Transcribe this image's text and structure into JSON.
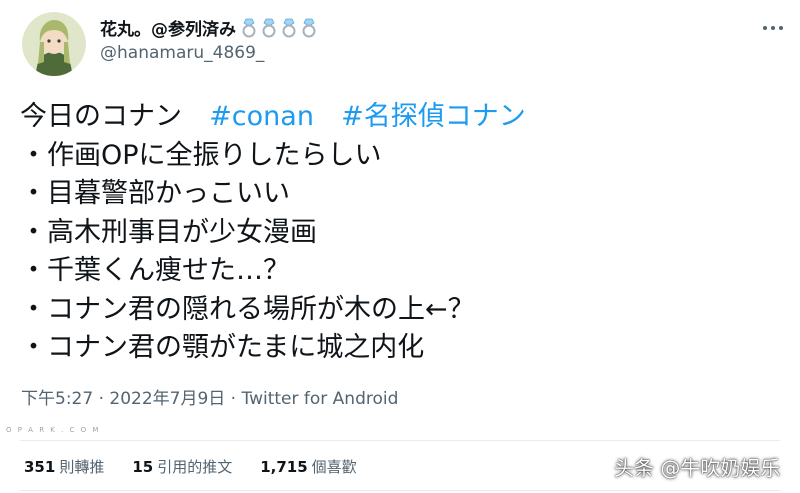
{
  "user": {
    "display_name": "花丸。@参列済み",
    "handle": "@hanamaru_4869_",
    "badge_icons": [
      "ring-icon",
      "ring-icon",
      "ring-icon",
      "ring-icon"
    ]
  },
  "tweet": {
    "line1_text": "今日のコナン",
    "hashtags": [
      "#conan",
      "#名探偵コナン"
    ],
    "bullets": [
      "・作画OPに全振りしたらしい",
      "・目暮警部かっこいい",
      "・高木刑事目が少女漫画",
      "・千葉くん痩せた…？",
      "・コナン君の隠れる場所が木の上←？",
      "・コナン君の顎がたまに城之内化"
    ]
  },
  "meta": {
    "timestamp": "下午5:27 · 2022年7月9日 · ",
    "source": "Twitter for Android"
  },
  "stats": {
    "retweets_count": "351",
    "retweets_label": "則轉推",
    "quotes_count": "15",
    "quotes_label": "引用的推文",
    "likes_count": "1,715",
    "likes_label": "個喜歡"
  },
  "watermarks": {
    "small": "O P A R K . C O M",
    "attribution": "头条 @牛吹奶娱乐"
  },
  "colors": {
    "hashtag": "#1d9bf0",
    "secondary_text": "#536471",
    "primary_text": "#0f1419",
    "divider": "#e6ecf0"
  }
}
